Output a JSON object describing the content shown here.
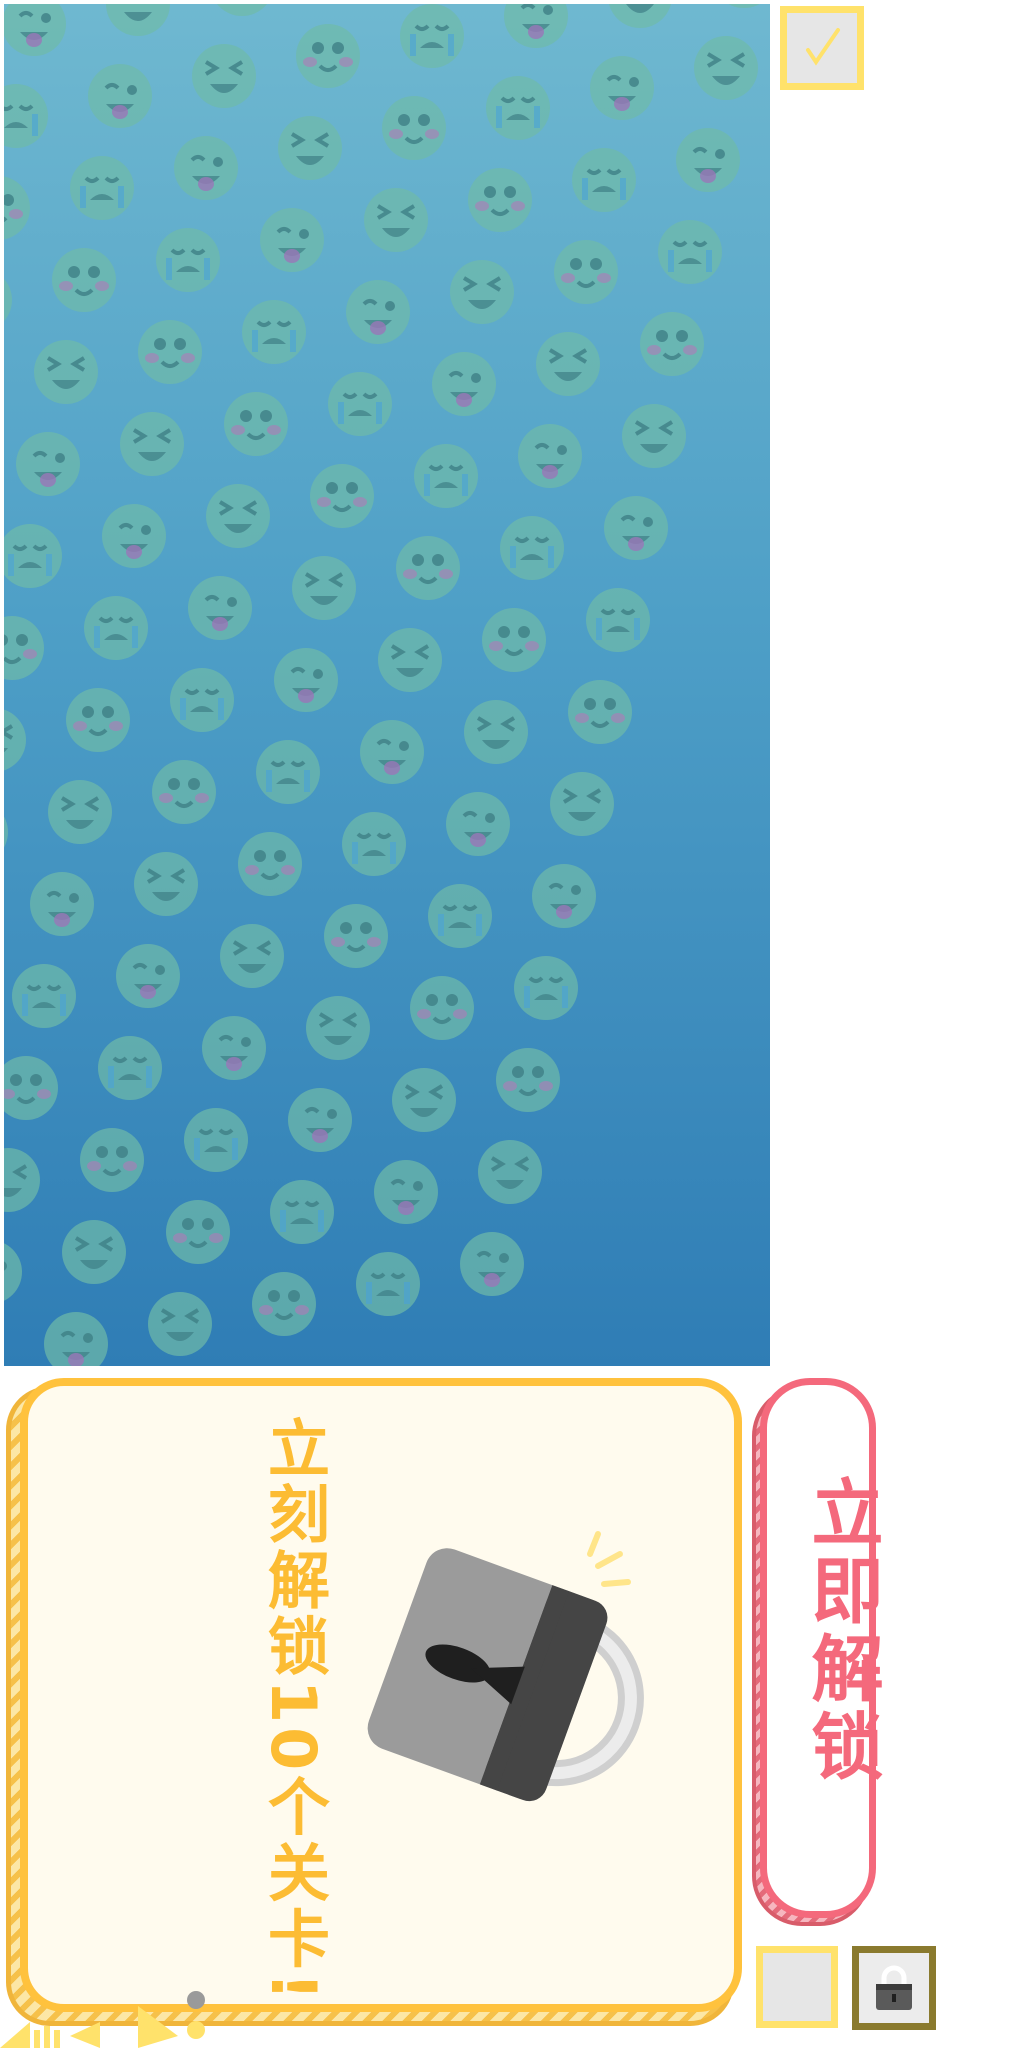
{
  "promo": {
    "title": "立刻解锁10个关卡!"
  },
  "unlock_button": {
    "label": "立即解锁"
  },
  "icons": {
    "background_pattern": "emoji-pattern",
    "check": "check-icon",
    "padlock": "padlock-icon",
    "slot_lock": "lock-icon",
    "sound": "sound-icon",
    "play": "play-icon",
    "dots": "dots-icon"
  },
  "colors": {
    "promo_accent": "#ffc23d",
    "unlock_accent": "#f4697c",
    "slot_border": "#ffe26b",
    "locked_slot_border": "#8a7a2e",
    "panel_top": "#6fb8d0",
    "panel_bottom": "#2f7db5"
  }
}
